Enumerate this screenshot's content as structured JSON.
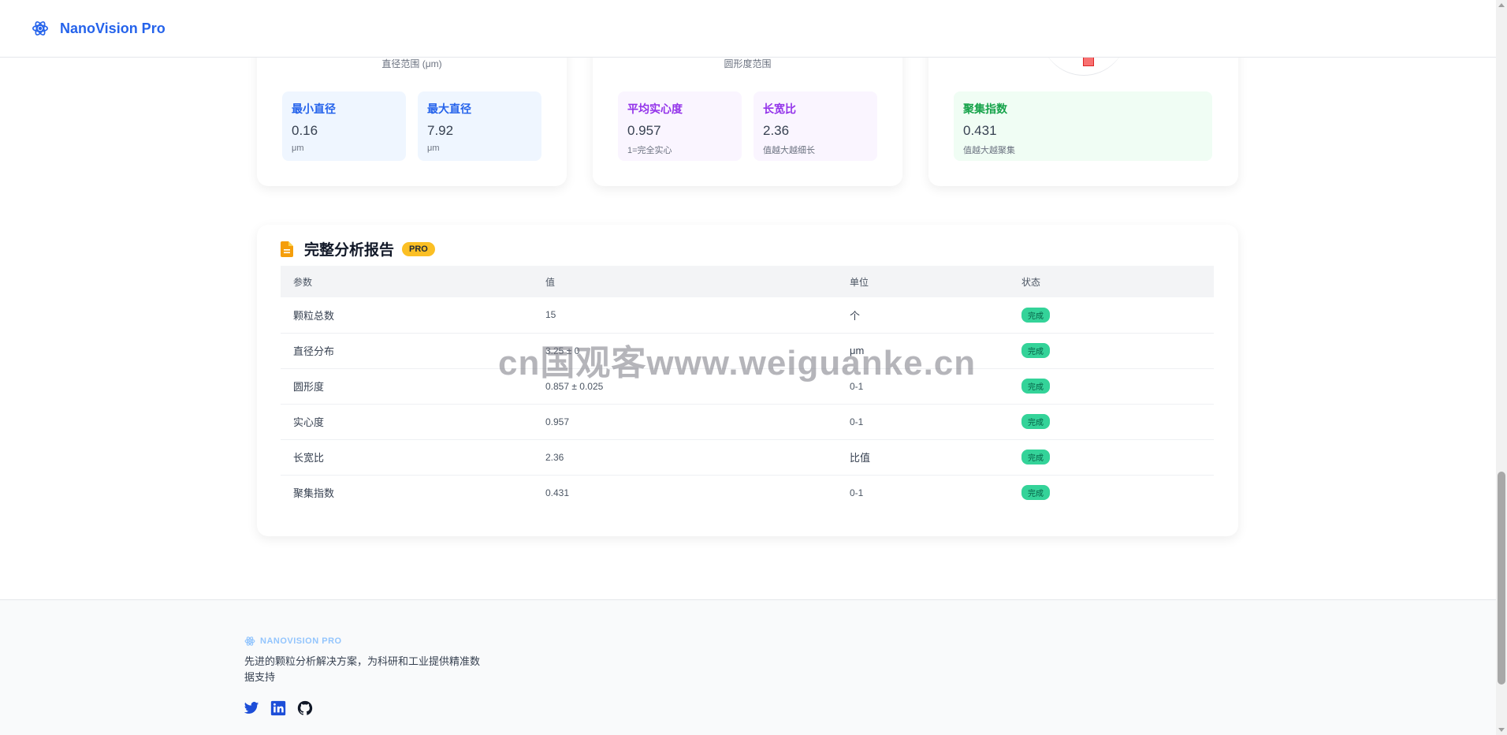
{
  "header": {
    "brand": "NanoVision Pro"
  },
  "cards": [
    {
      "caption": "直径范围 (μm)",
      "stats": [
        {
          "label": "最小直径",
          "value": "0.16",
          "sub": "μm"
        },
        {
          "label": "最大直径",
          "value": "7.92",
          "sub": "μm"
        }
      ]
    },
    {
      "caption": "圆形度范围",
      "stats": [
        {
          "label": "平均实心度",
          "value": "0.957",
          "sub": "1=完全实心"
        },
        {
          "label": "长宽比",
          "value": "2.36",
          "sub": "值越大越细长"
        }
      ]
    },
    {
      "stats": [
        {
          "label": "聚集指数",
          "value": "0.431",
          "sub": "值越大越聚集"
        }
      ]
    }
  ],
  "report": {
    "title": "完整分析报告",
    "badge": "PRO",
    "columns": [
      "参数",
      "值",
      "单位",
      "状态"
    ],
    "rows": [
      {
        "param": "颗粒总数",
        "value": "15",
        "unit": "个",
        "status": "完成"
      },
      {
        "param": "直径分布",
        "value": "3.25 ± 0",
        "unit": "μm",
        "status": "完成"
      },
      {
        "param": "圆形度",
        "value": "0.857 ± 0.025",
        "unit": "0-1",
        "status": "完成"
      },
      {
        "param": "实心度",
        "value": "0.957",
        "unit": "0-1",
        "status": "完成"
      },
      {
        "param": "长宽比",
        "value": "2.36",
        "unit": "比值",
        "status": "完成"
      },
      {
        "param": "聚集指数",
        "value": "0.431",
        "unit": "0-1",
        "status": "完成"
      }
    ]
  },
  "watermark": "cn国观客www.weiguanke.cn",
  "footer": {
    "brand": "NANOVISION PRO",
    "description": "先进的颗粒分析解决方案，为科研和工业提供精准数据支持",
    "social": [
      "twitter-icon",
      "linkedin-icon",
      "github-icon"
    ]
  },
  "colors": {
    "accent": "#2563eb",
    "badge": "#fbbf24",
    "status": "#34d399"
  }
}
